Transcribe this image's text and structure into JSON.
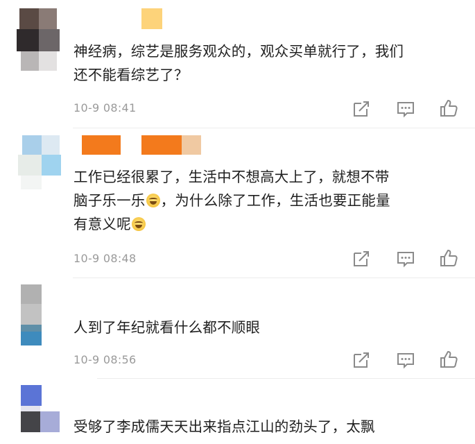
{
  "comments": [
    {
      "lines": [
        "神经病，综艺是服务观众的，观众买单就行了，我们",
        "还不能看综艺了？"
      ],
      "time": "10-9 08:41",
      "actions": [
        "share-icon",
        "comment-icon",
        "like-icon"
      ]
    },
    {
      "line1": "工作已经很累了，生活中不想高大上了，就想不带",
      "line2a": "脑子乐一乐",
      "line2b": "，为什么除了工作，生活也要正能量",
      "line3": "有意义呢",
      "time": "10-9 08:48",
      "actions": [
        "share-icon",
        "comment-icon",
        "like-icon"
      ]
    },
    {
      "lines": [
        "人到了年纪就看什么都不顺眼"
      ],
      "time": "10-9 08:56",
      "actions": [
        "share-icon",
        "comment-icon",
        "like-icon"
      ]
    },
    {
      "lines": [
        "受够了李成儒天天出来指点江山的劲头了，太飘"
      ]
    }
  ],
  "colors": {
    "text": "#1f1f1f",
    "time": "#9a9a9a",
    "icon": "#8a8a8a",
    "divider": "#ececec"
  }
}
